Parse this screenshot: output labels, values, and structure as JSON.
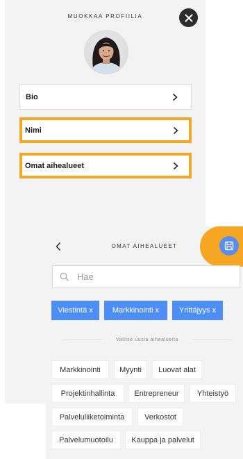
{
  "profile": {
    "title": "MUOKKAA PROFIILIA",
    "items": [
      {
        "label": "Bio"
      },
      {
        "label": "Nimi"
      },
      {
        "label": "Omat aihealueet"
      }
    ]
  },
  "topics": {
    "title": "OMAT AIHEALUEET",
    "search_placeholder": "Hae",
    "selected": [
      "Viestintä x",
      "Markkinointi x",
      "Yrittäjyys x"
    ],
    "divider_text": "Valitse uusia aihealueita",
    "available": [
      "Markkinointi",
      "Myynti",
      "Luovat alat",
      "Projektinhallinta",
      "Entrepreneur",
      "Yhteistyö",
      "Palveluliiketoiminta",
      "Verkostot",
      "Palvelumuotoilu",
      "Kauppa ja palvelut"
    ]
  },
  "colors": {
    "highlight": "#f5a623",
    "accent_blue": "#4c8df6",
    "panel_bg": "#f3f3f3"
  },
  "icons": {
    "close": "close-icon",
    "chevron": "chevron-right-icon",
    "back": "chevron-left-icon",
    "save": "save-icon",
    "search": "search-icon"
  }
}
